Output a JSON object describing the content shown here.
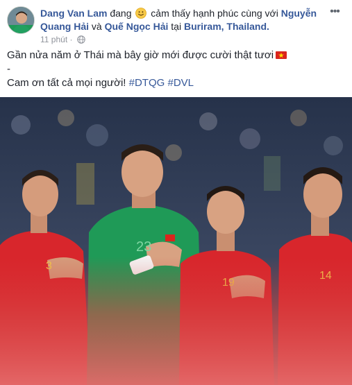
{
  "post": {
    "author": "Dang Van Lam",
    "feeling_prefix": "đang",
    "feeling_text": "cảm thấy hạnh phúc cùng với",
    "tagged_1": "Nguyễn Quang Hải",
    "conjunction": "và",
    "tagged_2": "Quế Ngọc Hải",
    "at_word": "tại",
    "location": "Buriram, Thailand.",
    "time": "11 phút",
    "privacy_icon": "globe-icon",
    "feeling_icon": "smiley-icon",
    "more_icon": "more-options-icon"
  },
  "content": {
    "line1": "Gần nửa năm ở Thái mà bây giờ mới được cười thật tươi",
    "flag_icon": "vietnam-flag-icon",
    "line2": "-",
    "line3_text": "Cam ơn tất cả mọi người!",
    "hashtag_1": "#DTQG",
    "hashtag_2": "#DVL"
  },
  "photo": {
    "jersey_numbers": [
      "3",
      "23",
      "19",
      "14"
    ]
  },
  "colors": {
    "link": "#365899",
    "meta": "#90949c",
    "jersey_red": "#d8262c",
    "keeper_green": "#1f9a57"
  }
}
